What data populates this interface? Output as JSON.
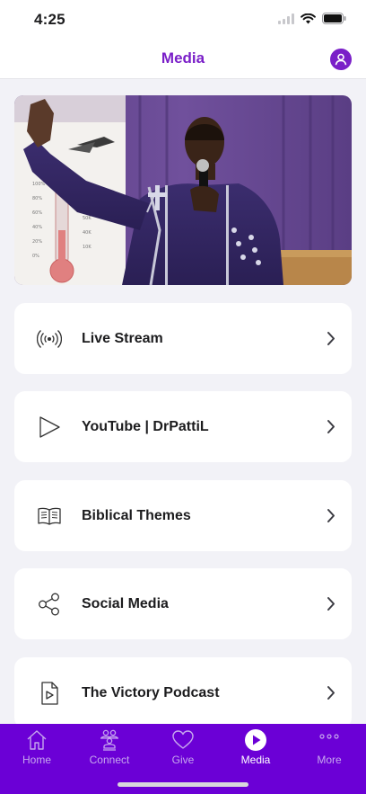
{
  "status_bar": {
    "time": "4:25"
  },
  "nav": {
    "title": "Media"
  },
  "menu": [
    {
      "label": "Live Stream",
      "icon": "broadcast-icon"
    },
    {
      "label": "YouTube | DrPattiL",
      "icon": "play-icon"
    },
    {
      "label": "Biblical Themes",
      "icon": "book-icon"
    },
    {
      "label": "Social Media",
      "icon": "share-icon"
    },
    {
      "label": "The Victory Podcast",
      "icon": "podcast-file-icon"
    }
  ],
  "tabs": [
    {
      "label": "Home",
      "icon": "home-icon"
    },
    {
      "label": "Connect",
      "icon": "people-icon"
    },
    {
      "label": "Give",
      "icon": "heart-icon"
    },
    {
      "label": "Media",
      "icon": "play-circle-icon",
      "active": true
    },
    {
      "label": "More",
      "icon": "more-icon"
    }
  ],
  "colors": {
    "accent": "#7a1fc8",
    "tab_bar": "#6b00d6",
    "background": "#f2f2f7"
  }
}
